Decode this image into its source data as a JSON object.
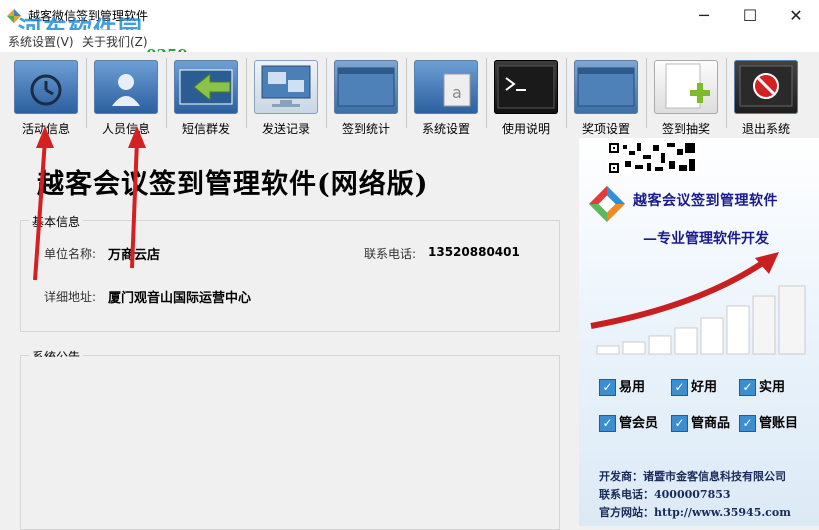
{
  "window": {
    "title": "越客微信签到管理软件",
    "watermark_text": "河东软件园",
    "watermark_url": "www.pc0359.cn",
    "minimize_glyph": "─",
    "maximize_glyph": "☐",
    "close_glyph": "✕"
  },
  "menu": [
    {
      "label": "系统设置(V)"
    },
    {
      "label": "关于我们(Z)"
    }
  ],
  "toolbar": [
    {
      "label": "活动信息",
      "icon": "history-folder-icon"
    },
    {
      "label": "人员信息",
      "icon": "person-folder-icon"
    },
    {
      "label": "短信群发",
      "icon": "arrow-left-icon"
    },
    {
      "label": "发送记录",
      "icon": "monitor-icon"
    },
    {
      "label": "签到统计",
      "icon": "window-icon"
    },
    {
      "label": "系统设置",
      "icon": "folder-doc-icon"
    },
    {
      "label": "使用说明",
      "icon": "terminal-icon"
    },
    {
      "label": "奖项设置",
      "icon": "window-icon"
    },
    {
      "label": "签到抽奖",
      "icon": "add-document-icon"
    },
    {
      "label": "退出系统",
      "icon": "stop-icon"
    }
  ],
  "app_title": "越客会议签到管理软件(网络版)",
  "basic_info": {
    "legend": "基本信息",
    "unit_label": "单位名称:",
    "unit_value": "万商云店",
    "phone_label": "联系电话:",
    "phone_value": "13520880401",
    "address_label": "详细地址:",
    "address_value": "厦门观音山国际运营中心"
  },
  "notice": {
    "legend": "系统公告",
    "content": ""
  },
  "ad": {
    "title": "越客会议签到管理软件",
    "subtitle": "—专业管理软件开发",
    "features": [
      "易用",
      "好用",
      "实用",
      "管会员",
      "管商品",
      "管账目"
    ],
    "developer": "开发商：诸暨市金客信息科技有限公司",
    "phone": "联系电话：4000007853",
    "website": "官方网站：http://www.35945.com"
  },
  "colors": {
    "accent_blue": "#1a1a8c",
    "arrow_red": "#d42020",
    "check_blue": "#3b8fd0"
  }
}
